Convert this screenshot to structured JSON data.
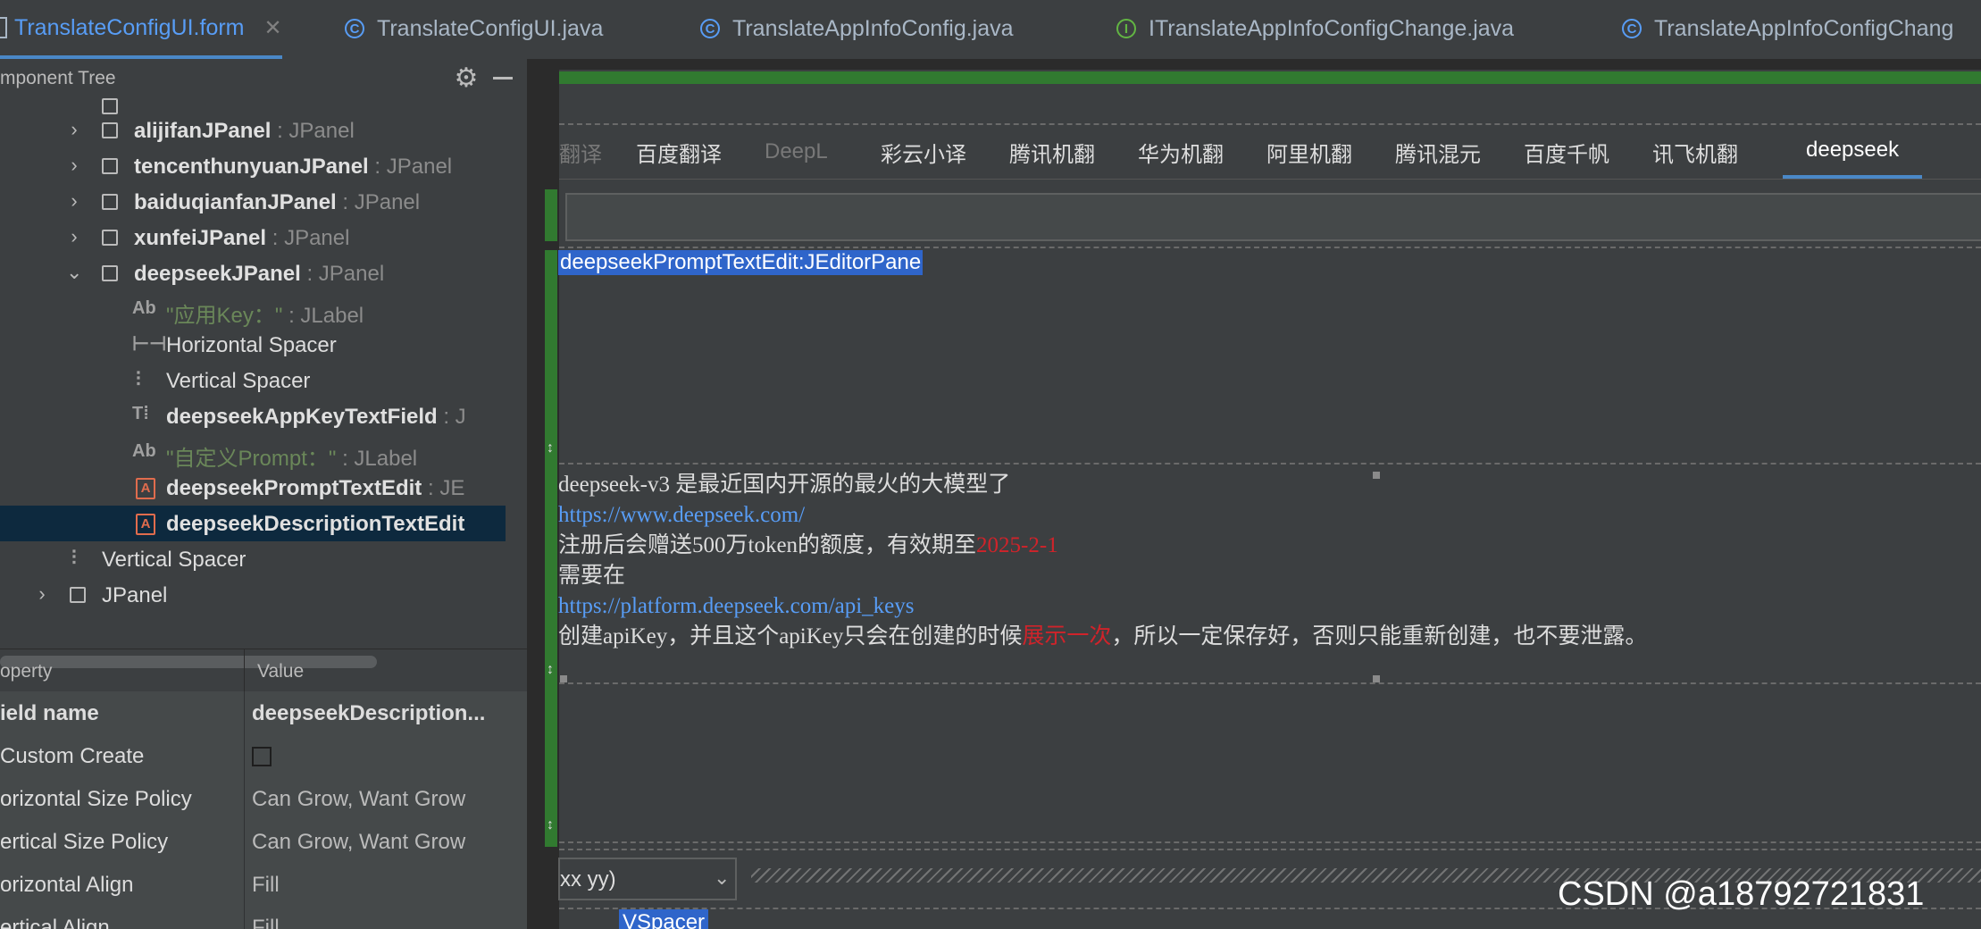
{
  "file_tabs": [
    {
      "label": "TranslateConfigUI.form",
      "icon": "form-icon",
      "active": true,
      "close": "✕"
    },
    {
      "label": "TranslateConfigUI.java",
      "icon": "class-icon",
      "icon_glyph": "C"
    },
    {
      "label": "TranslateAppInfoConfig.java",
      "icon": "class-icon",
      "icon_glyph": "C"
    },
    {
      "label": "ITranslateAppInfoConfigChange.java",
      "icon": "interface-icon",
      "icon_glyph": "I"
    },
    {
      "label": "TranslateAppInfoConfigChang",
      "icon": "class-icon",
      "icon_glyph": "C"
    }
  ],
  "component_tree": {
    "title": "mponent Tree",
    "items": [
      {
        "name": "alijifanJPanel",
        "type": " : JPanel",
        "kind": "panel"
      },
      {
        "name": "tencenthunyuanJPanel",
        "type": " : JPanel",
        "kind": "panel"
      },
      {
        "name": "baiduqianfanJPanel",
        "type": " : JPanel",
        "kind": "panel"
      },
      {
        "name": "xunfeiJPanel",
        "type": " : JPanel",
        "kind": "panel"
      },
      {
        "name": "deepseekJPanel",
        "type": " : JPanel",
        "kind": "panel-open"
      },
      {
        "name": "\"应用Key：\"",
        "type": " : JLabel",
        "kind": "label"
      },
      {
        "name": "Horizontal Spacer",
        "kind": "hspacer"
      },
      {
        "name": "Vertical Spacer",
        "kind": "vspacer"
      },
      {
        "name": "deepseekAppKeyTextField",
        "type": " : J",
        "kind": "textfield"
      },
      {
        "name": "\"自定义Prompt：\"",
        "type": " : JLabel",
        "kind": "label"
      },
      {
        "name": "deepseekPromptTextEdit",
        "type": " : JE",
        "kind": "editor"
      },
      {
        "name": "deepseekDescriptionTextEdit",
        "kind": "editor",
        "selected": true
      },
      {
        "name": "Vertical Spacer",
        "kind": "vspacer"
      },
      {
        "name": "JPanel",
        "kind": "panel"
      }
    ]
  },
  "properties": {
    "header": {
      "property": "operty",
      "value": "Value"
    },
    "rows": [
      {
        "name": "ield name",
        "value": "deepseekDescription..."
      },
      {
        "name": "Custom Create",
        "checkbox": true
      },
      {
        "name": "orizontal Size Policy",
        "value": "Can Grow, Want Grow"
      },
      {
        "name": "ertical Size Policy",
        "value": "Can Grow, Want Grow"
      },
      {
        "name": "orizontal Align",
        "value": "Fill"
      },
      {
        "name": "ertical Align",
        "value": "Fill"
      }
    ]
  },
  "designer": {
    "panel_tabs": [
      {
        "label": "翻译",
        "disabled": true
      },
      {
        "label": "百度翻译"
      },
      {
        "label": "DeepL",
        "disabled": true
      },
      {
        "label": "彩云小译"
      },
      {
        "label": "腾讯机翻"
      },
      {
        "label": "华为机翻"
      },
      {
        "label": "阿里机翻"
      },
      {
        "label": "腾讯混元"
      },
      {
        "label": "百度千帆"
      },
      {
        "label": "讯飞机翻"
      },
      {
        "label": "deepseek",
        "selected": true
      }
    ],
    "prompt_component_label": "deepseekPromptTextEdit:JEditorPane",
    "description": {
      "line1": "deepseek-v3 是最近国内开源的最火的大模型了",
      "link1": "https://www.deepseek.com/",
      "line3_a": "注册后会赠送500万token的额度，有效期至",
      "line3_red": "2025-2-1",
      "line4": "需要在",
      "link2": "https://platform.deepseek.com/api_keys",
      "line6_a": "创建apiKey，并且这个apiKey只会在创建的时候",
      "line6_red": "展示一次",
      "line6_b": "，所以一定保存好，否则只能重新创建，也不要泄露。"
    },
    "combo_value": "xx yy)",
    "vspacer_label": "VSpacer"
  },
  "watermark": "CSDN @a18792721831"
}
